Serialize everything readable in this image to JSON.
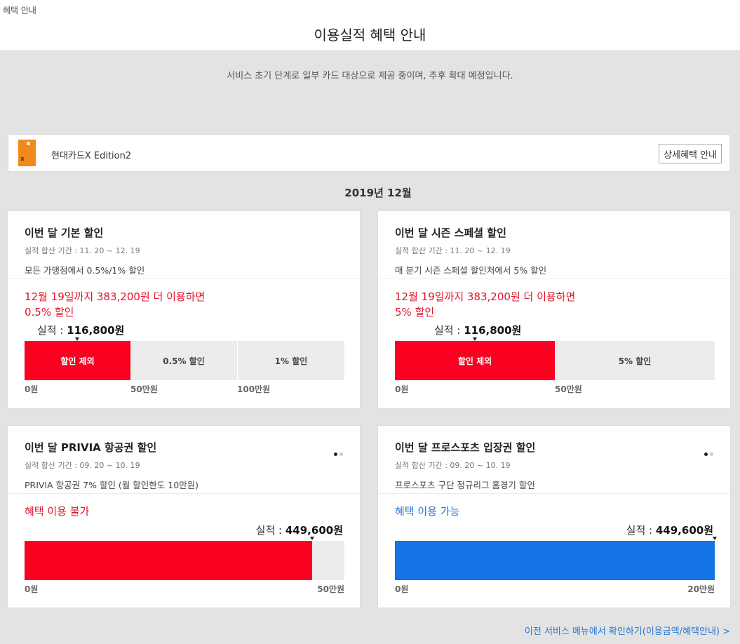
{
  "tab_label": "혜택 안내",
  "page_title": "이용실적 혜택 안내",
  "notice": "서비스 초기 단계로 일부 카드 대상으로 제공 중이며, 추후 확대 예정입니다.",
  "card": {
    "name": "현대카드X Edition2",
    "thumb_mark": "x",
    "detail_button": "상세혜택 안내",
    "color": "#f08a1e"
  },
  "month": "2019년 12월",
  "panels": [
    {
      "title": "이번 달 기본 할인",
      "period": "실적 합산 기간 : 11. 20 ~ 12. 19",
      "desc": "모든 가맹점에서 0.5%/1% 할인",
      "message_line1": "12월 19일까지 383,200원 더 이용하면",
      "message_line2": "0.5% 할인",
      "perf_label": "실적 : ",
      "perf_value": "116,800원",
      "segments": [
        "할인 제외",
        "0.5% 할인",
        "1% 할인"
      ],
      "ticks": [
        "0원",
        "50만원",
        "100만원"
      ]
    },
    {
      "title": "이번 달 시즌 스페셜 할인",
      "period": "실적 합산 기간 : 11. 20 ~ 12. 19",
      "desc": "매 분기 시즌 스페셜 할인처에서 5% 할인",
      "message_line1": "12월 19일까지 383,200원 더 이용하면",
      "message_line2": "5% 할인",
      "perf_label": "실적 : ",
      "perf_value": "116,800원",
      "segments": [
        "할인 제외",
        "5% 할인"
      ],
      "ticks": [
        "0원",
        "50만원"
      ]
    },
    {
      "title": "이번 달 PRIVIA 항공권 할인",
      "period": "실적 합산 기간 : 09. 20 ~ 10. 19",
      "desc": "PRIVIA 항공권 7% 할인 (월 할인한도 10만원)",
      "message": "혜택 이용 불가",
      "perf_label": "실적 : ",
      "perf_value": "449,600원",
      "progress_fraction": 0.8992,
      "ticks": [
        "0원",
        "50만원"
      ]
    },
    {
      "title": "이번 달 프로스포츠 입장권 할인",
      "period": "실적 합산 기간 : 09. 20 ~ 10. 19",
      "desc": "프로스포츠 구단 정규리그 홈경기 할인",
      "message": "혜택 이용 가능",
      "perf_label": "실적 : ",
      "perf_value": "449,600원",
      "progress_fraction": 1.0,
      "ticks": [
        "0원",
        "20만원"
      ]
    }
  ],
  "footer_link": "이전 서비스 메뉴에서 확인하기(이용금액/혜택안내) >",
  "colors": {
    "red": "#fa0021",
    "blue": "#1473e6",
    "link": "#2a77d2",
    "bg": "#e3e3e3"
  }
}
